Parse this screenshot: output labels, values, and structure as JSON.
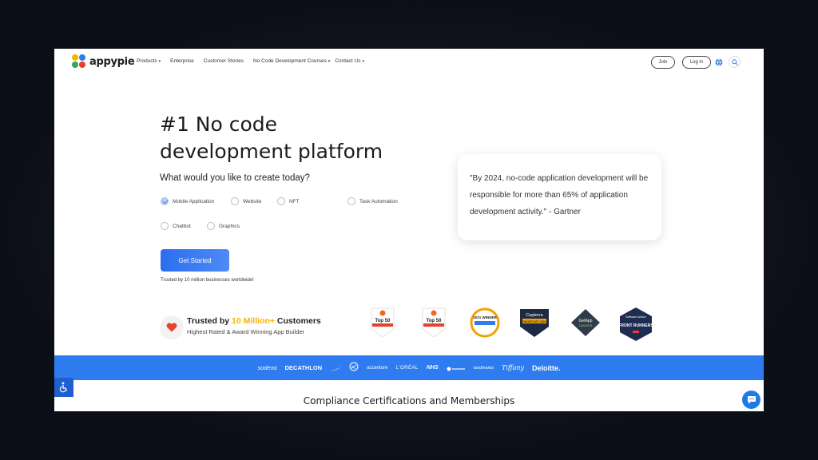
{
  "header": {
    "brand": "appypie",
    "menu": [
      {
        "label": "Products",
        "dropdown": true
      },
      {
        "label": "Enterprise",
        "dropdown": false
      },
      {
        "label": "Customer Stories",
        "dropdown": false
      },
      {
        "label": "No Code Development Courses",
        "dropdown": true
      },
      {
        "label": "Contact Us",
        "dropdown": true
      }
    ],
    "join_label": "Join",
    "login_label": "Log in",
    "icons": [
      "globe-icon",
      "search-icon"
    ]
  },
  "hero": {
    "title_line1": "#1 No code",
    "title_line2": "development platform",
    "subtitle": "What would you like to create today?",
    "options": [
      {
        "label": "Mobile Application",
        "checked": true
      },
      {
        "label": "Website",
        "checked": false
      },
      {
        "label": "NFT",
        "checked": false
      },
      {
        "label": "Task Automation",
        "checked": false
      },
      {
        "label": "Chatbot",
        "checked": false
      },
      {
        "label": "Graphics",
        "checked": false
      }
    ],
    "cta_label": "Get Started",
    "trusted_line": "Trusted by 10 million businesses worldwide!"
  },
  "quote": {
    "text": "\"By 2024, no-code application development will be responsible for more than 65% of application development activity.\" - Gartner"
  },
  "trust": {
    "title_prefix": "Trusted by ",
    "title_highlight": "10 Million+",
    "title_suffix": " Customers",
    "subtitle": "Highest Rated & Award Winning App Builder",
    "highlight_color": "#f4b400",
    "badges": [
      {
        "top": "Top 50",
        "icon": "g2-badge-icon"
      },
      {
        "top": "Top 50",
        "icon": "g2-badge-icon"
      },
      {
        "top": "2021 WINNER",
        "icon": "award-winner-badge-icon"
      },
      {
        "top": "Capterra",
        "bottom": "SHORTLIST 2021",
        "icon": "capterra-badge-icon"
      },
      {
        "top": "GetApp",
        "bottom": "LEADERS",
        "icon": "getapp-badge-icon"
      },
      {
        "top": "Software Advice",
        "bottom": "FRONT RUNNERS",
        "icon": "software-advice-badge-icon"
      }
    ]
  },
  "brands": [
    "sodexo",
    "DECATHLON",
    "nike-logo",
    "sb-logo",
    "accenture",
    "L'ORÉAL",
    "NHS",
    "brand-logo",
    "landmarks",
    "Tiffany",
    "Deloitte."
  ],
  "colors": {
    "accent": "#2e7cf0",
    "cta": "#2b6ef0",
    "badge_red": "#e8412c",
    "dark_navy": "#1d2a44"
  },
  "footer": {
    "section_title": "Compliance Certifications and Memberships",
    "icons": [
      "accessibility-icon",
      "chat-icon"
    ]
  }
}
